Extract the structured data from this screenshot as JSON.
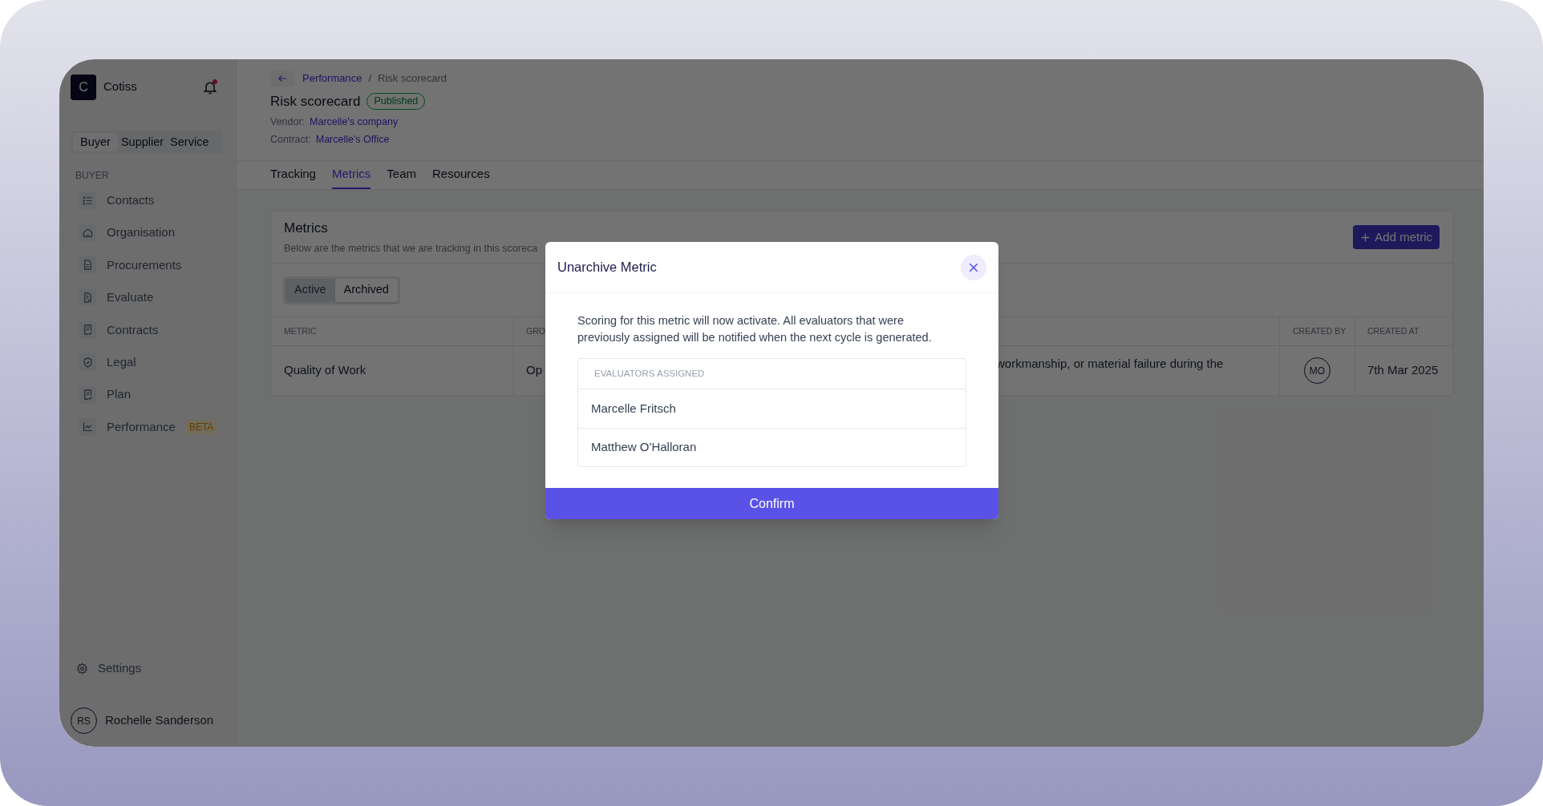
{
  "app": {
    "logo_letter": "C",
    "name": "Cotiss",
    "notifications_unread": true
  },
  "workspace_switch": [
    {
      "label": "Buyer",
      "selected": true
    },
    {
      "label": "Supplier",
      "selected": false
    },
    {
      "label": "Service",
      "selected": false
    }
  ],
  "sidebar": {
    "section": "BUYER",
    "items": [
      {
        "label": "Contacts"
      },
      {
        "label": "Organisation"
      },
      {
        "label": "Procurements"
      },
      {
        "label": "Evaluate"
      },
      {
        "label": "Contracts"
      },
      {
        "label": "Legal"
      },
      {
        "label": "Plan"
      },
      {
        "label": "Performance",
        "badge": "BETA"
      }
    ]
  },
  "settings": "Settings",
  "user": {
    "initials": "RS",
    "name": "Rochelle Sanderson"
  },
  "breadcrumb": {
    "parent": "Performance",
    "separator": "/",
    "current": "Risk scorecard"
  },
  "title": "Risk scorecard",
  "status": "Published",
  "details": [
    {
      "label": "Vendor:",
      "value": "Marcelle's company"
    },
    {
      "label": "Contract:",
      "value": "Marcelle's Office"
    }
  ],
  "tabs": [
    {
      "label": "Tracking",
      "selected": false
    },
    {
      "label": "Metrics",
      "selected": true
    },
    {
      "label": "Team",
      "selected": false
    },
    {
      "label": "Resources",
      "selected": false
    }
  ],
  "card": {
    "title": "Metrics",
    "description": "Below are the metrics that we are tracking in this scoreca",
    "add_button": "Add metric",
    "filter": [
      {
        "label": "Active",
        "selected": false
      },
      {
        "label": "Archived",
        "selected": true
      }
    ]
  },
  "table": {
    "columns": {
      "metric": "METRIC",
      "group": "GRO",
      "created_by": "CREATED BY",
      "created_at": "CREATED AT"
    },
    "rows": [
      {
        "metric": "Quality of Work",
        "group": "Op",
        "description": "workmanship, or material failure during the",
        "created_by": "MO",
        "created_at": "7th Mar 2025"
      }
    ]
  },
  "modal": {
    "title": "Unarchive Metric",
    "message": "Scoring for this metric will now activate. All evaluators that were previously assigned will be notified when the next cycle is generated.",
    "list_header": "EVALUATORS ASSIGNED",
    "evaluators": [
      "Marcelle Fritsch",
      "Matthew O'Halloran"
    ],
    "confirm": "Confirm"
  }
}
